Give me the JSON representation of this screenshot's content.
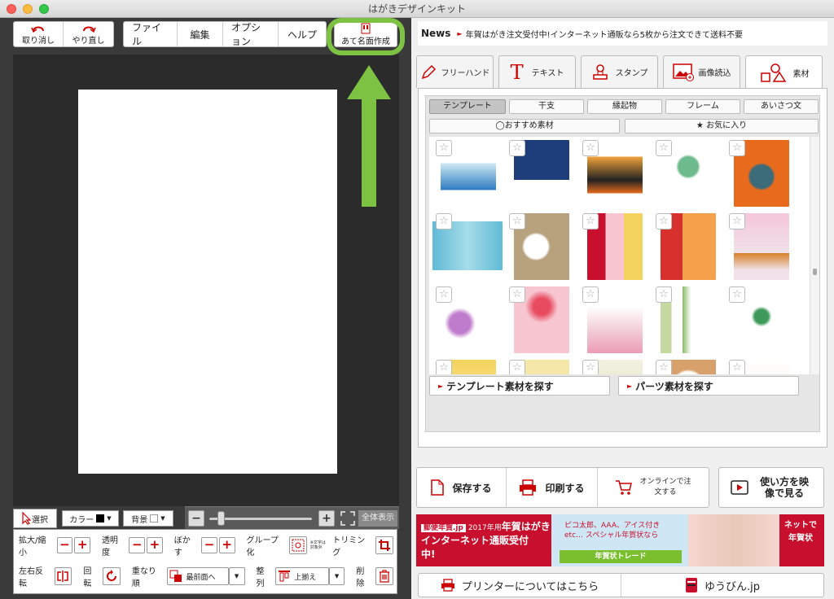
{
  "window": {
    "title": "はがきデザインキット"
  },
  "toolbar": {
    "undo": "取り消し",
    "redo": "やり直し",
    "menu": [
      "ファイル",
      "編集",
      "オプション",
      "ヘルプ"
    ],
    "address": "あて名面作成"
  },
  "news": {
    "label": "News",
    "text": "年賀はがき注文受付中!インターネット通販なら5枚から注文できて送料不要"
  },
  "tabs": [
    "フリーハンド",
    "テキスト",
    "スタンプ",
    "画像読込",
    "素材"
  ],
  "categories": [
    "テンプレート",
    "干支",
    "縁起物",
    "フレーム",
    "あいさつ文"
  ],
  "subcats": [
    "おすすめ素材",
    "お気に入り"
  ],
  "search": {
    "template": "テンプレート素材を探す",
    "parts": "パーツ素材を探す"
  },
  "actions": {
    "save": "保存する",
    "print": "印刷する",
    "online": "オンラインで注文する",
    "video": "使い方を映像で見る"
  },
  "banner": {
    "brand": "郵便年賀.jp",
    "year": "2017年用",
    "product": "年賀はがき",
    "headline": "インターネット通販受付中!",
    "mid": "ピコ太郎、AAA、アイス付きetc… スペシャル年賀状なら",
    "trade": "年賀状トレード",
    "right": "ネットで 年賀状"
  },
  "links": {
    "printer": "プリンターについてはこちら",
    "yubin": "ゆうびん.jp"
  },
  "controls": {
    "select": "選択",
    "color": "カラー",
    "background": "背景",
    "full": "全体表示",
    "zoom": "拡大/縮小",
    "opacity": "透明度",
    "blur": "ぼかす",
    "group": "グループ化",
    "group_note": "※文字は対象外",
    "trim": "トリミング",
    "flip": "左右反転",
    "rotate": "回転",
    "order": "重なり順",
    "order_value": "最前面へ",
    "align": "整列",
    "align_value": "上揃え",
    "delete": "削除"
  },
  "colors": {
    "accent": "#c8102e",
    "highlight": "#7dc242"
  }
}
